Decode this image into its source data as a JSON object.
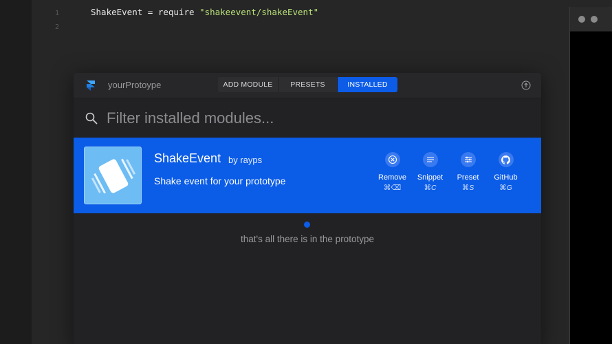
{
  "editor": {
    "line_numbers": [
      "1",
      "2"
    ],
    "code": {
      "prefix": "ShakeEvent = require ",
      "string": "\"shakeevent/shakeEvent\""
    }
  },
  "modal": {
    "project_name": "yourProtoype",
    "tabs": [
      {
        "label": "ADD MODULE",
        "active": false
      },
      {
        "label": "PRESETS",
        "active": false
      },
      {
        "label": "INSTALLED",
        "active": true
      }
    ],
    "search": {
      "placeholder": "Filter installed modules...",
      "value": ""
    },
    "modules": [
      {
        "name": "ShakeEvent",
        "author": "by rayps",
        "description": "Shake event for your prototype",
        "actions": [
          {
            "label": "Remove",
            "shortcut": "⌘⌫",
            "icon": "close-circle-icon"
          },
          {
            "label": "Snippet",
            "shortcut": "⌘C",
            "icon": "lines-icon"
          },
          {
            "label": "Preset",
            "shortcut": "⌘S",
            "icon": "sliders-icon"
          },
          {
            "label": "GitHub",
            "shortcut": "⌘G",
            "icon": "github-icon"
          }
        ]
      }
    ],
    "end_message": "that's all there is in the prototype"
  },
  "colors": {
    "accent": "#0c5ce8",
    "module_row": "#0b5ce6",
    "string": "#b9e27a"
  }
}
